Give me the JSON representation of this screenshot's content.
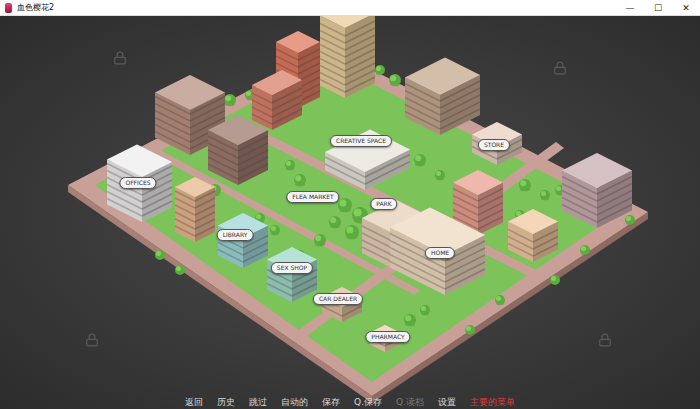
{
  "window": {
    "title": "血色樱花2",
    "controls": [
      "—",
      "☐",
      "✕"
    ]
  },
  "locations": [
    {
      "label": "CREATIVE SPACE"
    },
    {
      "label": "STORE"
    },
    {
      "label": "OFFICES"
    },
    {
      "label": "FLEA MARKET"
    },
    {
      "label": "PARK"
    },
    {
      "label": "LIBRARY"
    },
    {
      "label": "HOME"
    },
    {
      "label": "SEX SHOP"
    },
    {
      "label": "CAR DEALER"
    },
    {
      "label": "PHARMACY"
    }
  ],
  "menu": [
    {
      "label": "返回",
      "disabled": false,
      "color": "#dcdcdc"
    },
    {
      "label": "历史",
      "disabled": false,
      "color": "#dcdcdc"
    },
    {
      "label": "跳过",
      "disabled": false,
      "color": "#dcdcdc"
    },
    {
      "label": "自动的",
      "disabled": false,
      "color": "#dcdcdc"
    },
    {
      "label": "保存",
      "disabled": false,
      "color": "#dcdcdc"
    },
    {
      "label": "Q.保存",
      "disabled": false,
      "color": "#dcdcdc"
    },
    {
      "label": "Q.读档",
      "disabled": true,
      "color": "#7a7a7a"
    },
    {
      "label": "设置",
      "disabled": false,
      "color": "#dcdcdc"
    },
    {
      "label": "主要的菜单",
      "disabled": false,
      "color": "#e03a3a"
    }
  ]
}
